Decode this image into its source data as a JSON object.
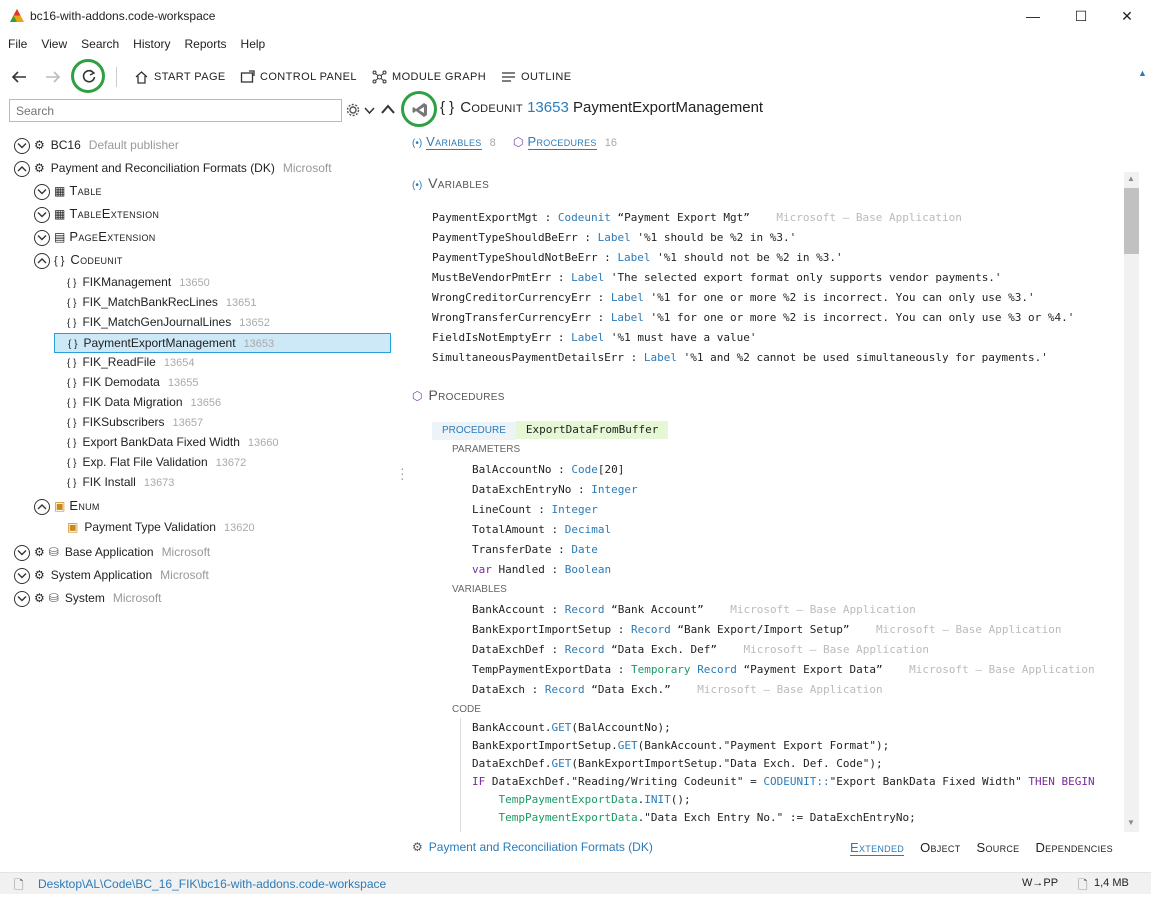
{
  "window": {
    "title": "bc16-with-addons.code-workspace",
    "minimize": "—",
    "maximize": "☐",
    "close": "✕"
  },
  "menu": [
    "File",
    "View",
    "Search",
    "History",
    "Reports",
    "Help"
  ],
  "toolbar": {
    "start_page": "START PAGE",
    "control_panel": "CONTROL PANEL",
    "module_graph": "MODULE GRAPH",
    "outline": "OUTLINE"
  },
  "search": {
    "placeholder": "Search"
  },
  "tree": {
    "bc16": {
      "name": "BC16",
      "publisher": "Default publisher"
    },
    "payment": {
      "name": "Payment and Reconciliation Formats (DK)",
      "publisher": "Microsoft"
    },
    "table": "Table",
    "table_extension": "TableExtension",
    "page_extension": "PageExtension",
    "codeunit": "Codeunit",
    "codeunits": [
      {
        "name": "FIKManagement",
        "id": "13650"
      },
      {
        "name": "FIK_MatchBankRecLines",
        "id": "13651"
      },
      {
        "name": "FIK_MatchGenJournalLines",
        "id": "13652"
      },
      {
        "name": "PaymentExportManagement",
        "id": "13653"
      },
      {
        "name": "FIK_ReadFile",
        "id": "13654"
      },
      {
        "name": "FIK Demodata",
        "id": "13655"
      },
      {
        "name": "FIK Data Migration",
        "id": "13656"
      },
      {
        "name": "FIKSubscribers",
        "id": "13657"
      },
      {
        "name": "Export BankData Fixed Width",
        "id": "13660"
      },
      {
        "name": "Exp. Flat File Validation",
        "id": "13672"
      },
      {
        "name": "FIK Install",
        "id": "13673"
      }
    ],
    "enum": "Enum",
    "enum_item": {
      "name": "Payment Type Validation",
      "id": "13620"
    },
    "base_app": {
      "name": "Base Application",
      "publisher": "Microsoft"
    },
    "system_app": {
      "name": "System Application",
      "publisher": "Microsoft"
    },
    "system": {
      "name": "System",
      "publisher": "Microsoft"
    }
  },
  "detail": {
    "kind": "Codeunit",
    "id": "13653",
    "name": "PaymentExportManagement",
    "braces": "{ }",
    "tabs": {
      "variables": "Variables",
      "variables_count": "8",
      "procedures": "Procedures",
      "procedures_count": "16"
    },
    "variables_heading": "Variables",
    "procedures_heading": "Procedures",
    "variables": [
      {
        "name": "PaymentExportMgt",
        "type": "Codeunit",
        "value": "“Payment Export Mgt”",
        "source": "Microsoft — Base Application"
      },
      {
        "name": "PaymentTypeShouldBeErr",
        "type": "Label",
        "value": "'%1 should be %2 in %3.'",
        "source": ""
      },
      {
        "name": "PaymentTypeShouldNotBeErr",
        "type": "Label",
        "value": "'%1 should not be %2 in %3.'",
        "source": ""
      },
      {
        "name": "MustBeVendorPmtErr",
        "type": "Label",
        "value": "'The selected export format only supports vendor payments.'",
        "source": ""
      },
      {
        "name": "WrongCreditorCurrencyErr",
        "type": "Label",
        "value": "'%1 for one or more %2 is incorrect. You can only use %3.'",
        "source": ""
      },
      {
        "name": "WrongTransferCurrencyErr",
        "type": "Label",
        "value": "'%1 for one or more %2 is incorrect. You can only use %3 or %4.'",
        "source": ""
      },
      {
        "name": "FieldIsNotEmptyErr",
        "type": "Label",
        "value": "'%1 must have a value'",
        "source": ""
      },
      {
        "name": "SimultaneousPaymentDetailsErr",
        "type": "Label",
        "value": "'%1 and %2 cannot be used simultaneously for payments.'",
        "source": ""
      }
    ],
    "procedure": {
      "keyword": "PROCEDURE",
      "name": "ExportDataFromBuffer",
      "parameters_label": "PARAMETERS",
      "parameters": [
        {
          "var": "",
          "name": "BalAccountNo",
          "type": "Code",
          "suffix": "[20]"
        },
        {
          "var": "",
          "name": "DataExchEntryNo",
          "type": "Integer",
          "suffix": ""
        },
        {
          "var": "",
          "name": "LineCount",
          "type": "Integer",
          "suffix": ""
        },
        {
          "var": "",
          "name": "TotalAmount",
          "type": "Decimal",
          "suffix": ""
        },
        {
          "var": "",
          "name": "TransferDate",
          "type": "Date",
          "suffix": ""
        },
        {
          "var": "var",
          "name": "Handled",
          "type": "Boolean",
          "suffix": ""
        }
      ],
      "variables_label": "VARIABLES",
      "variables": [
        {
          "name": "BankAccount",
          "type": "Record",
          "value": "“Bank Account”",
          "source": "Microsoft — Base Application"
        },
        {
          "name": "BankExportImportSetup",
          "type": "Record",
          "value": "“Bank Export/Import Setup”",
          "source": "Microsoft — Base Application"
        },
        {
          "name": "DataExchDef",
          "type": "Record",
          "value": "“Data Exch. Def”",
          "source": "Microsoft — Base Application"
        },
        {
          "name": "TempPaymentExportData",
          "type": "Temporary Record",
          "value": "“Payment Export Data”",
          "source": "Microsoft — Base Application"
        },
        {
          "name": "DataExch",
          "type": "Record",
          "value": "“Data Exch.”",
          "source": "Microsoft — Base Application"
        }
      ],
      "code_label": "CODE",
      "code_lines": [
        "BankAccount.GET(BalAccountNo);",
        "BankExportImportSetup.GET(BankAccount.\"Payment Export Format\");",
        "DataExchDef.GET(BankExportImportSetup.\"Data Exch. Def. Code\");",
        "IF DataExchDef.\"Reading/Writing Codeunit\" = CODEUNIT::\"Export BankData Fixed Width\" THEN BEGIN",
        "    TempPaymentExportData.INIT();",
        "    TempPaymentExportData.\"Data Exch Entry No.\" := DataExchEntryNo;"
      ]
    }
  },
  "bottom_bar": {
    "module": "Payment and Reconciliation Formats (DK)",
    "tabs": [
      "Extended",
      "Object",
      "Source",
      "Dependencies"
    ]
  },
  "status": {
    "path": "Desktop\\AL\\Code\\BC_16_FIK\\bc16-with-addons.code-workspace",
    "mode": "W→PP",
    "size": "1,4 MB"
  },
  "colors": {
    "accent": "#2b7bb9",
    "selection": "#cde8f6",
    "highlight_ring": "#2ea043",
    "keyword": "#7a2a9a",
    "proc_bg": "#e6f7d6"
  }
}
